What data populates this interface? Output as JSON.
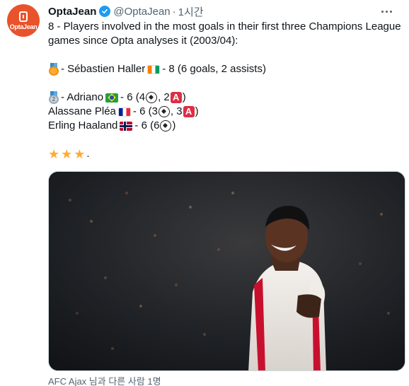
{
  "avatar": {
    "label": "OptaJean"
  },
  "header": {
    "name": "OptaJean",
    "handle": "@OptaJean",
    "separator": "·",
    "time": "1시간"
  },
  "tweet": {
    "line1": "8 - Players involved in the most goals in their first three Champions League",
    "line2": "games since Opta analyses it (2003/04):",
    "haller": {
      "text_a": " - Sébastien Haller ",
      "text_b": " - 8 (6 goals, 2 assists)"
    },
    "adriano": {
      "text_a": " - Adriano ",
      "text_b": " - 6 (4 ",
      "text_c": ", 2 ",
      "text_d": ")"
    },
    "plea": {
      "text_a": "Alassane Pléa ",
      "text_b": " - 6 (3 ",
      "text_c": ", 3 ",
      "text_d": ")"
    },
    "haaland": {
      "text_a": "Erling Haaland ",
      "text_b": " - 6 (6 ",
      "text_c": ")"
    },
    "assist_glyph": "A",
    "medal_silver_number": "2",
    "stars_suffix": "."
  },
  "media": {
    "alt": "Sébastien Haller celebrating"
  },
  "tag": {
    "text": "AFC Ajax 님과 다른 사람 1명"
  },
  "colors": {
    "accent": "#1d9bf0",
    "avatar": "#e8532b",
    "muted": "#536471"
  }
}
